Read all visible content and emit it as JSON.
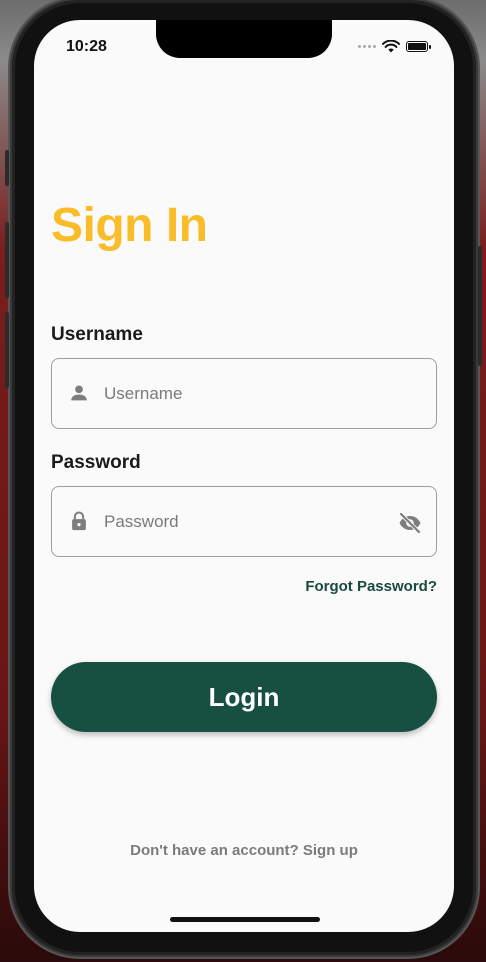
{
  "status_bar": {
    "time": "10:28",
    "icons": [
      "signal-dots-icon",
      "wifi-icon",
      "battery-icon"
    ]
  },
  "screen": {
    "title": "Sign In",
    "username": {
      "label": "Username",
      "placeholder": "Username",
      "value": "",
      "icon": "person-icon"
    },
    "password": {
      "label": "Password",
      "placeholder": "Password",
      "value": "",
      "icon": "lock-icon",
      "toggle_icon": "eye-off-icon"
    },
    "forgot_password": "Forgot Password?",
    "login_button": "Login",
    "signup_prompt": "Don't have an account? Sign up"
  },
  "colors": {
    "title": "#f9bd2a",
    "primary": "#174f40",
    "link": "#1a4a3e",
    "background": "#fafafa"
  }
}
